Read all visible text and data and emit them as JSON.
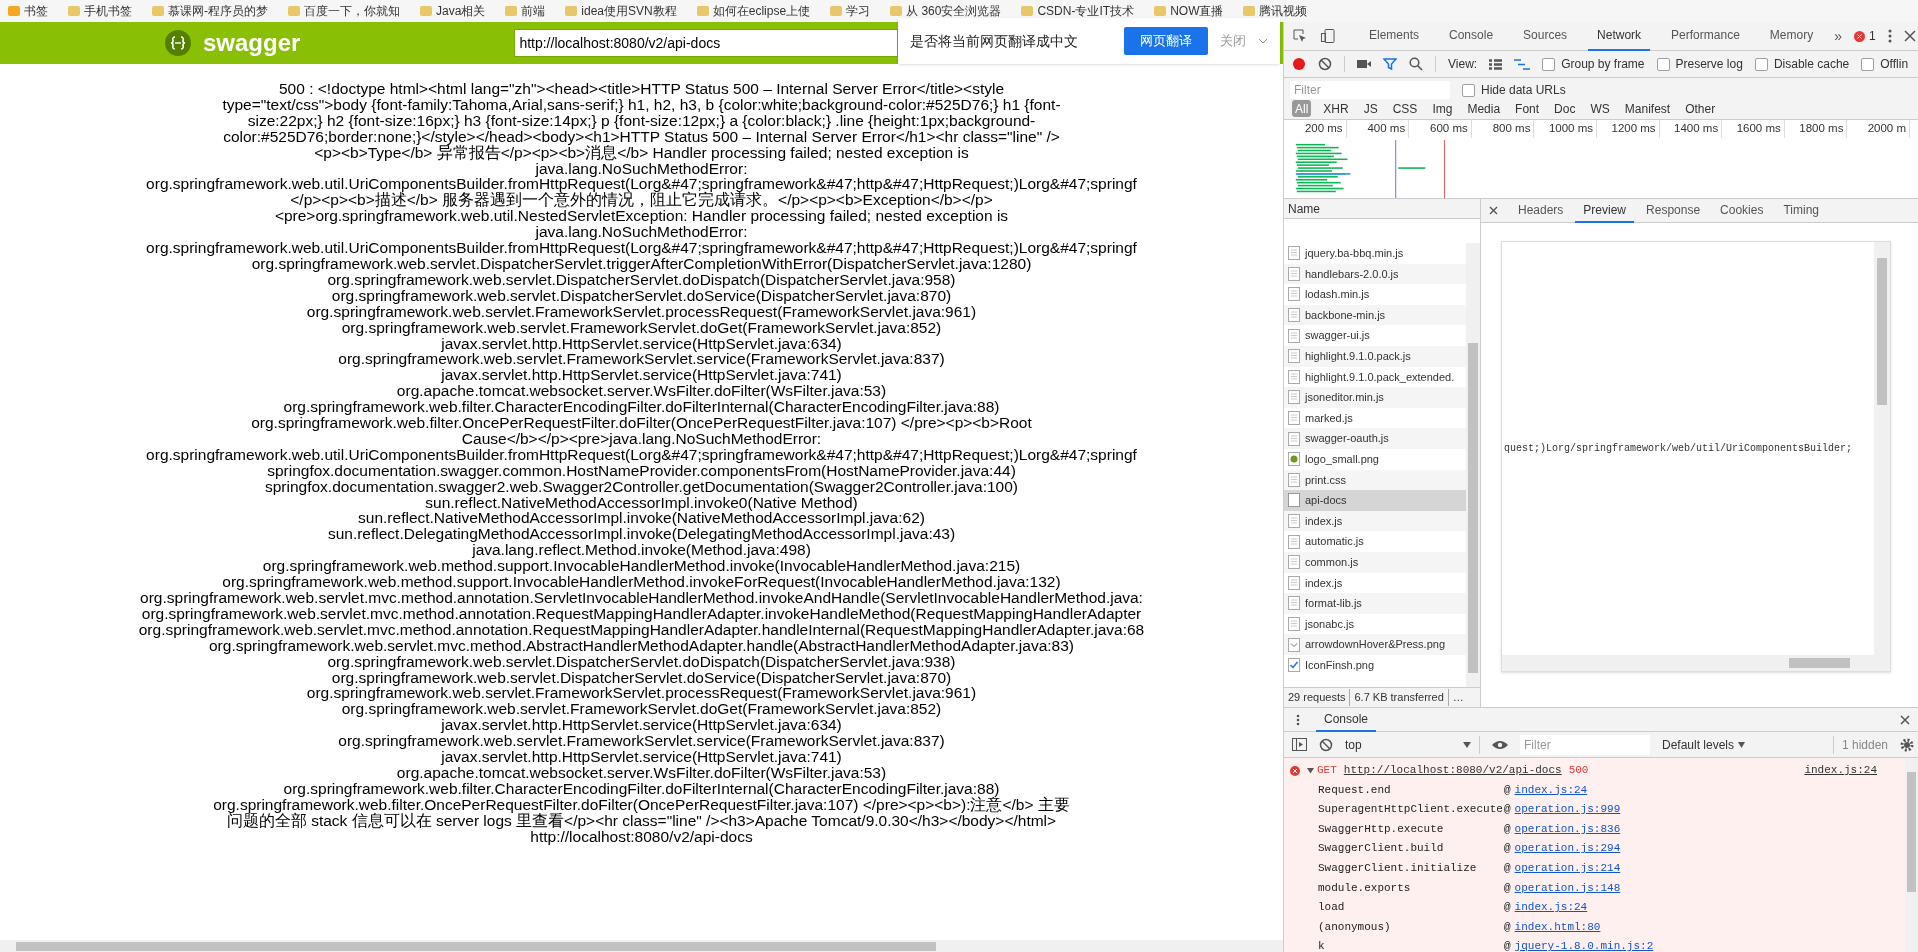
{
  "bookmarks": [
    "书签",
    "手机书签",
    "慕课网-程序员的梦",
    "百度一下，你就知",
    "Java相关",
    "前端",
    "idea使用SVN教程",
    "如何在eclipse上使",
    "学习",
    "从 360安全浏览器",
    "CSDN-专业IT技术",
    "NOW直播",
    "腾讯视频"
  ],
  "swagger": {
    "title": "swagger",
    "url": "http://localhost:8080/v2/api-docs"
  },
  "translate_bar": {
    "prompt": "是否将当前网页翻译成中文",
    "button": "网页翻译",
    "close": "关闭"
  },
  "error_page": {
    "lines": [
      "500 : <!doctype html><html lang=\"zh\"><head><title>HTTP Status 500 – Internal Server Error</title><style",
      "type=\"text/css\">body {font-family:Tahoma,Arial,sans-serif;} h1, h2, h3, b {color:white;background-color:#525D76;} h1 {font-",
      "size:22px;} h2 {font-size:16px;} h3 {font-size:14px;} p {font-size:12px;} a {color:black;} .line {height:1px;background-",
      "color:#525D76;border:none;}</style></head><body><h1>HTTP Status 500 – Internal Server Error</h1><hr class=\"line\" />",
      "<p><b>Type</b> 异常报告</p><p><b>消息</b> Handler processing failed; nested exception is",
      "java.lang.NoSuchMethodError:",
      "org.springframework.web.util.UriComponentsBuilder.fromHttpRequest(Lorg&#47;springframework&#47;http&#47;HttpRequest;)Lorg&#47;springf",
      "</p><p><b>描述</b> 服务器遇到一个意外的情况，阻止它完成请求。</p><p><b>Exception</b></p>",
      "<pre>org.springframework.web.util.NestedServletException: Handler processing failed; nested exception is",
      "java.lang.NoSuchMethodError:",
      "org.springframework.web.util.UriComponentsBuilder.fromHttpRequest(Lorg&#47;springframework&#47;http&#47;HttpRequest;)Lorg&#47;springf",
      "org.springframework.web.servlet.DispatcherServlet.triggerAfterCompletionWithError(DispatcherServlet.java:1280)",
      "org.springframework.web.servlet.DispatcherServlet.doDispatch(DispatcherServlet.java:958)",
      "org.springframework.web.servlet.DispatcherServlet.doService(DispatcherServlet.java:870)",
      "org.springframework.web.servlet.FrameworkServlet.processRequest(FrameworkServlet.java:961)",
      "org.springframework.web.servlet.FrameworkServlet.doGet(FrameworkServlet.java:852)",
      "javax.servlet.http.HttpServlet.service(HttpServlet.java:634)",
      "org.springframework.web.servlet.FrameworkServlet.service(FrameworkServlet.java:837)",
      "javax.servlet.http.HttpServlet.service(HttpServlet.java:741)",
      "org.apache.tomcat.websocket.server.WsFilter.doFilter(WsFilter.java:53)",
      "org.springframework.web.filter.CharacterEncodingFilter.doFilterInternal(CharacterEncodingFilter.java:88)",
      "org.springframework.web.filter.OncePerRequestFilter.doFilter(OncePerRequestFilter.java:107) </pre><p><b>Root",
      "Cause</b></p><pre>java.lang.NoSuchMethodError:",
      "org.springframework.web.util.UriComponentsBuilder.fromHttpRequest(Lorg&#47;springframework&#47;http&#47;HttpRequest;)Lorg&#47;springf",
      "springfox.documentation.swagger.common.HostNameProvider.componentsFrom(HostNameProvider.java:44)",
      "springfox.documentation.swagger2.web.Swagger2Controller.getDocumentation(Swagger2Controller.java:100)",
      "sun.reflect.NativeMethodAccessorImpl.invoke0(Native Method)",
      "sun.reflect.NativeMethodAccessorImpl.invoke(NativeMethodAccessorImpl.java:62)",
      "sun.reflect.DelegatingMethodAccessorImpl.invoke(DelegatingMethodAccessorImpl.java:43)",
      "java.lang.reflect.Method.invoke(Method.java:498)",
      "org.springframework.web.method.support.InvocableHandlerMethod.invoke(InvocableHandlerMethod.java:215)",
      "org.springframework.web.method.support.InvocableHandlerMethod.invokeForRequest(InvocableHandlerMethod.java:132)",
      "org.springframework.web.servlet.mvc.method.annotation.ServletInvocableHandlerMethod.invokeAndHandle(ServletInvocableHandlerMethod.java:",
      "org.springframework.web.servlet.mvc.method.annotation.RequestMappingHandlerAdapter.invokeHandleMethod(RequestMappingHandlerAdapter",
      "org.springframework.web.servlet.mvc.method.annotation.RequestMappingHandlerAdapter.handleInternal(RequestMappingHandlerAdapter.java:68",
      "org.springframework.web.servlet.mvc.method.AbstractHandlerMethodAdapter.handle(AbstractHandlerMethodAdapter.java:83)",
      "org.springframework.web.servlet.DispatcherServlet.doDispatch(DispatcherServlet.java:938)",
      "org.springframework.web.servlet.DispatcherServlet.doService(DispatcherServlet.java:870)",
      "org.springframework.web.servlet.FrameworkServlet.processRequest(FrameworkServlet.java:961)",
      "org.springframework.web.servlet.FrameworkServlet.doGet(FrameworkServlet.java:852)",
      "javax.servlet.http.HttpServlet.service(HttpServlet.java:634)",
      "org.springframework.web.servlet.FrameworkServlet.service(FrameworkServlet.java:837)",
      "javax.servlet.http.HttpServlet.service(HttpServlet.java:741)",
      "org.apache.tomcat.websocket.server.WsFilter.doFilter(WsFilter.java:53)",
      "org.springframework.web.filter.CharacterEncodingFilter.doFilterInternal(CharacterEncodingFilter.java:88)",
      "org.springframework.web.filter.OncePerRequestFilter.doFilter(OncePerRequestFilter.java:107) </pre><p><b>):注意</b> 主要",
      "问题的全部 stack 信息可以在 server logs 里查看</p><hr class=\"line\" /><h3>Apache Tomcat/9.0.30</h3></body></html>",
      "http://localhost:8080/v2/api-docs"
    ]
  },
  "devtools": {
    "tabs": [
      {
        "label": "Elements",
        "selected": false
      },
      {
        "label": "Console",
        "selected": false
      },
      {
        "label": "Sources",
        "selected": false
      },
      {
        "label": "Network",
        "selected": true
      },
      {
        "label": "Performance",
        "selected": false
      },
      {
        "label": "Memory",
        "selected": false
      }
    ],
    "more": "»",
    "error_count": "1",
    "toolbar": {
      "recording": true,
      "view_label": "View:",
      "checkboxes": [
        {
          "label": "Group by frame",
          "checked": false
        },
        {
          "label": "Preserve log",
          "checked": false
        },
        {
          "label": "Disable cache",
          "checked": false
        },
        {
          "label": "Offlin",
          "checked": false
        }
      ]
    },
    "filter": {
      "placeholder": "Filter",
      "hide_data_urls": {
        "label": "Hide data URLs",
        "checked": false
      }
    },
    "types": [
      {
        "label": "All",
        "selected": true
      },
      {
        "label": "XHR",
        "selected": false
      },
      {
        "label": "JS",
        "selected": false
      },
      {
        "label": "CSS",
        "selected": false
      },
      {
        "label": "Img",
        "selected": false
      },
      {
        "label": "Media",
        "selected": false
      },
      {
        "label": "Font",
        "selected": false
      },
      {
        "label": "Doc",
        "selected": false
      },
      {
        "label": "WS",
        "selected": false
      },
      {
        "label": "Manifest",
        "selected": false
      },
      {
        "label": "Other",
        "selected": false
      }
    ],
    "timeline_ticks": [
      "200 ms",
      "400 ms",
      "600 ms",
      "800 ms",
      "1000 ms",
      "1200 ms",
      "1400 ms",
      "1600 ms",
      "1800 ms",
      "2000 m"
    ],
    "name_header": "Name",
    "requests": [
      {
        "name": "jquery.ba-bbq.min.js",
        "kind": "file",
        "selected": false
      },
      {
        "name": "handlebars-2.0.0.js",
        "kind": "file",
        "selected": false
      },
      {
        "name": "lodash.min.js",
        "kind": "file",
        "selected": false
      },
      {
        "name": "backbone-min.js",
        "kind": "file",
        "selected": false
      },
      {
        "name": "swagger-ui.js",
        "kind": "file",
        "selected": false
      },
      {
        "name": "highlight.9.1.0.pack.js",
        "kind": "file",
        "selected": false
      },
      {
        "name": "highlight.9.1.0.pack_extended.",
        "kind": "file",
        "selected": false
      },
      {
        "name": "jsoneditor.min.js",
        "kind": "file",
        "selected": false
      },
      {
        "name": "marked.js",
        "kind": "file",
        "selected": false
      },
      {
        "name": "swagger-oauth.js",
        "kind": "file",
        "selected": false
      },
      {
        "name": "logo_small.png",
        "kind": "logo",
        "selected": false
      },
      {
        "name": "print.css",
        "kind": "file",
        "selected": false
      },
      {
        "name": "api-docs",
        "kind": "blank",
        "selected": true
      },
      {
        "name": "index.js",
        "kind": "file",
        "selected": false
      },
      {
        "name": "automatic.js",
        "kind": "file",
        "selected": false
      },
      {
        "name": "common.js",
        "kind": "file",
        "selected": false
      },
      {
        "name": "index.js",
        "kind": "file",
        "selected": false
      },
      {
        "name": "format-lib.js",
        "kind": "file",
        "selected": false
      },
      {
        "name": "jsonabc.js",
        "kind": "file",
        "selected": false
      },
      {
        "name": "arrowdownHover&Press.png",
        "kind": "chevron",
        "selected": false
      },
      {
        "name": "IconFinsh.png",
        "kind": "check",
        "selected": false
      }
    ],
    "detail_tabs": [
      {
        "label": "Headers",
        "selected": false
      },
      {
        "label": "Preview",
        "selected": true
      },
      {
        "label": "Response",
        "selected": false
      },
      {
        "label": "Cookies",
        "selected": false
      },
      {
        "label": "Timing",
        "selected": false
      }
    ],
    "preview_text": "quest;)Lorg/springframework/web/util/UriComponentsBuilder;",
    "status": [
      "29 requests",
      "6.7 KB transferred",
      "…"
    ]
  },
  "console": {
    "tab": "Console",
    "context": "top",
    "filter_placeholder": "Filter",
    "levels": "Default levels",
    "hidden": "1 hidden",
    "error": {
      "expanded": true,
      "method": "GET",
      "url": "http://localhost:8080/v2/api-docs",
      "status": "500",
      "source": "index.js:24"
    },
    "stack": [
      {
        "fn": "Request.end",
        "at": "@",
        "link": "index.js:24"
      },
      {
        "fn": "SuperagentHttpClient.execute",
        "at": "@",
        "link": "operation.js:999"
      },
      {
        "fn": "SwaggerHttp.execute",
        "at": "@",
        "link": "operation.js:836"
      },
      {
        "fn": "SwaggerClient.build",
        "at": "@",
        "link": "operation.js:294"
      },
      {
        "fn": "SwaggerClient.initialize",
        "at": "@",
        "link": "operation.js:214"
      },
      {
        "fn": "module.exports",
        "at": "@",
        "link": "operation.js:148"
      },
      {
        "fn": "load",
        "at": "@",
        "link": "index.js:24"
      },
      {
        "fn": "(anonymous)",
        "at": "@",
        "link": "index.html:80"
      },
      {
        "fn": "k",
        "at": "@",
        "link": "jquery-1.8.0.min.js:2"
      }
    ]
  }
}
